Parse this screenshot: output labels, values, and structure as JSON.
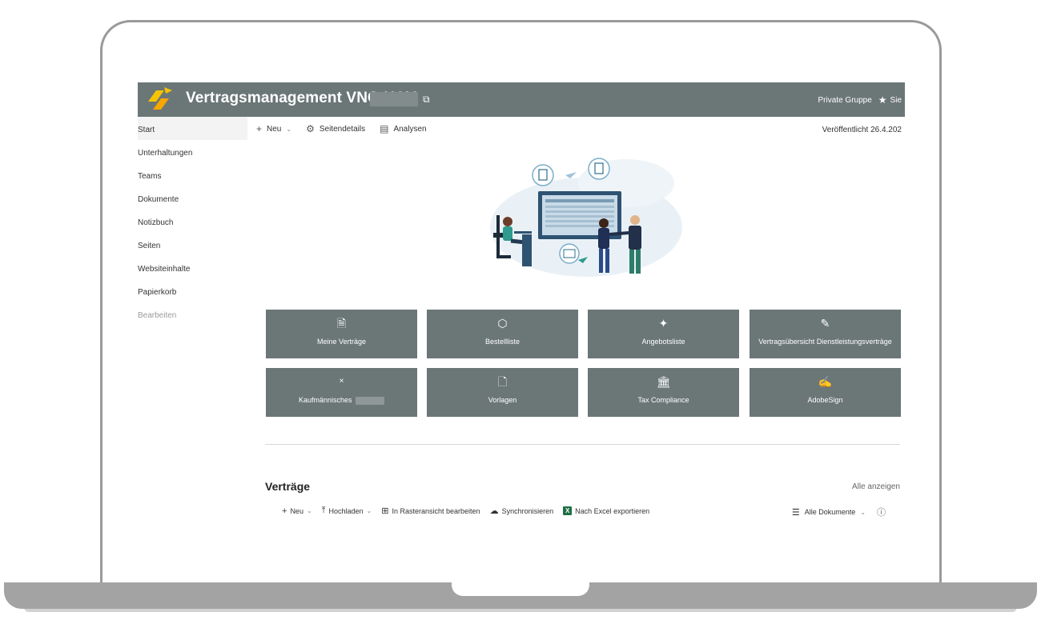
{
  "header": {
    "site_title": "Vertragsmanagement VNG H&V",
    "group_type": "Private Gruppe",
    "follow_label": "Sie"
  },
  "nav": {
    "items": [
      {
        "label": "Start"
      },
      {
        "label": "Unterhaltungen"
      },
      {
        "label": "Teams"
      },
      {
        "label": "Dokumente"
      },
      {
        "label": "Notizbuch"
      },
      {
        "label": "Seiten"
      },
      {
        "label": "Websiteinhalte"
      },
      {
        "label": "Papierkorb"
      },
      {
        "label": "Bearbeiten"
      }
    ]
  },
  "commandbar": {
    "new_label": "Neu",
    "page_details_label": "Seitendetails",
    "analytics_label": "Analysen",
    "published": "Veröffentlicht 26.4.202"
  },
  "tiles": [
    {
      "label": "Meine Verträge",
      "icon": "document-icon"
    },
    {
      "label": "Bestellliste",
      "icon": "package-icon"
    },
    {
      "label": "Angebotsliste",
      "icon": "handshake-icon"
    },
    {
      "label": "Vertragsübersicht Dienstleistungsverträge",
      "icon": "document-edit-icon"
    },
    {
      "label": "Kaufmännisches",
      "icon": "close-icon"
    },
    {
      "label": "Vorlagen",
      "icon": "page-icon"
    },
    {
      "label": "Tax Compliance",
      "icon": "bank-icon"
    },
    {
      "label": "AdobeSign",
      "icon": "sign-icon"
    }
  ],
  "documents": {
    "title": "Verträge",
    "see_all": "Alle anzeigen",
    "new_label": "Neu",
    "upload_label": "Hochladen",
    "grid_edit_label": "In Rasteransicht bearbeiten",
    "sync_label": "Synchronisieren",
    "export_label": "Nach Excel exportieren",
    "view_label": "Alle Dokumente"
  },
  "colors": {
    "header_bg": "#6b7677",
    "tile_bg": "#6b7677",
    "accent_yellow": "#f5c400"
  }
}
